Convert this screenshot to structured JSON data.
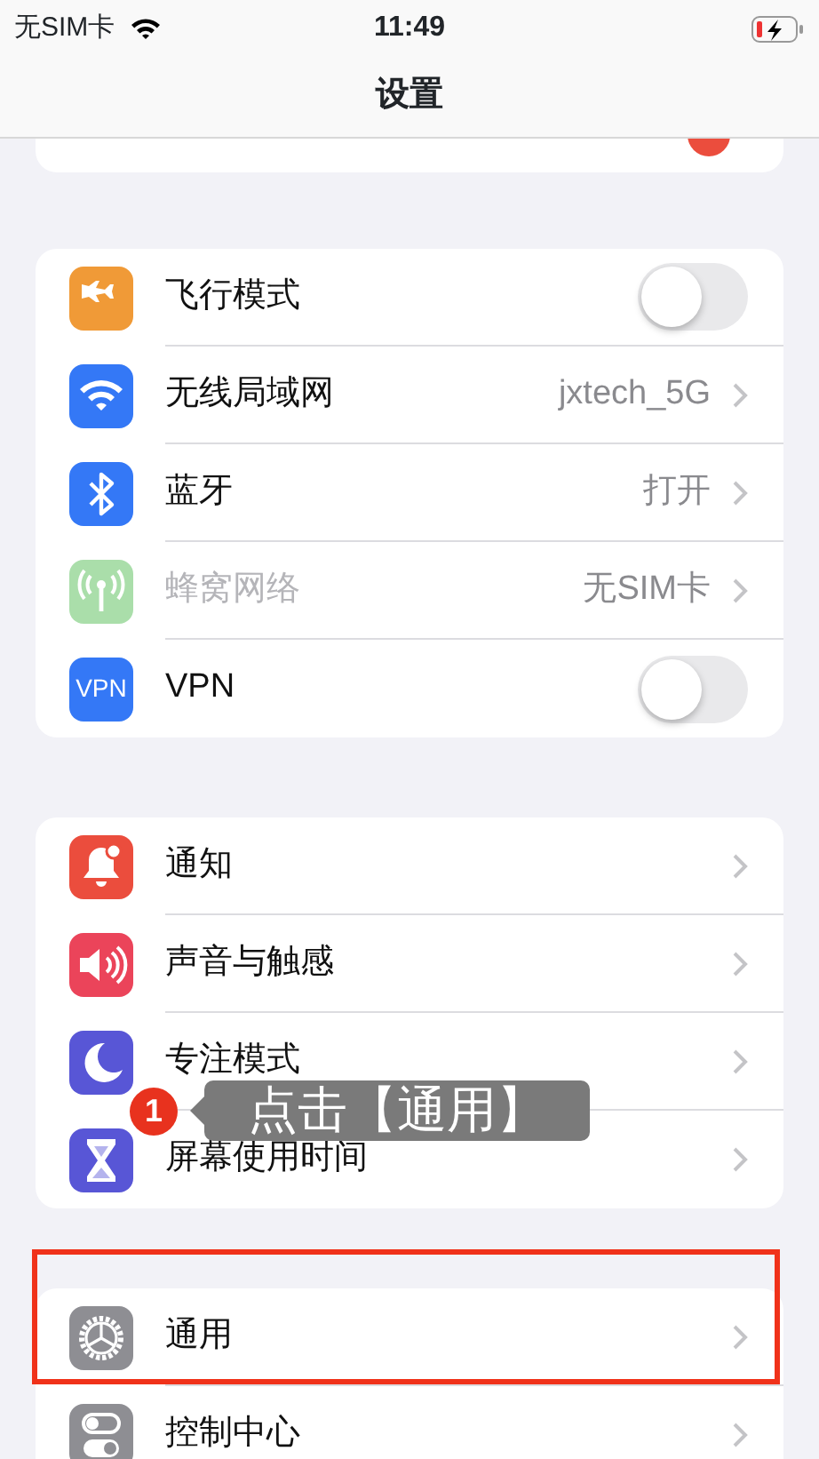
{
  "status_bar": {
    "carrier": "无SIM卡",
    "time": "11:49"
  },
  "title": "设置",
  "groups": [
    {
      "rows": [
        {
          "kind": "toggle",
          "label": "飞行模式",
          "on": false,
          "disabled": false,
          "highlighted": false
        },
        {
          "kind": "link",
          "label": "无线局域网",
          "value": "jxtech_5G",
          "disabled": false,
          "highlighted": false
        },
        {
          "kind": "link",
          "label": "蓝牙",
          "value": "打开",
          "disabled": false,
          "highlighted": false
        },
        {
          "kind": "link",
          "label": "蜂窝网络",
          "value": "无SIM卡",
          "disabled": true,
          "highlighted": false
        },
        {
          "kind": "toggle",
          "label": "VPN",
          "icon_text": "VPN",
          "on": false,
          "disabled": false,
          "highlighted": false
        }
      ]
    },
    {
      "rows": [
        {
          "kind": "link",
          "label": "通知",
          "disabled": false,
          "highlighted": false
        },
        {
          "kind": "link",
          "label": "声音与触感",
          "disabled": false,
          "highlighted": false
        },
        {
          "kind": "link",
          "label": "专注模式",
          "disabled": false,
          "highlighted": false
        },
        {
          "kind": "link",
          "label": "屏幕使用时间",
          "disabled": false,
          "highlighted": false
        }
      ]
    },
    {
      "rows": [
        {
          "kind": "link",
          "label": "通用",
          "disabled": false,
          "highlighted": true
        },
        {
          "kind": "link",
          "label": "控制中心",
          "disabled": false,
          "highlighted": false
        }
      ]
    }
  ],
  "tooltip": {
    "step": "1",
    "text": "点击【通用】"
  }
}
